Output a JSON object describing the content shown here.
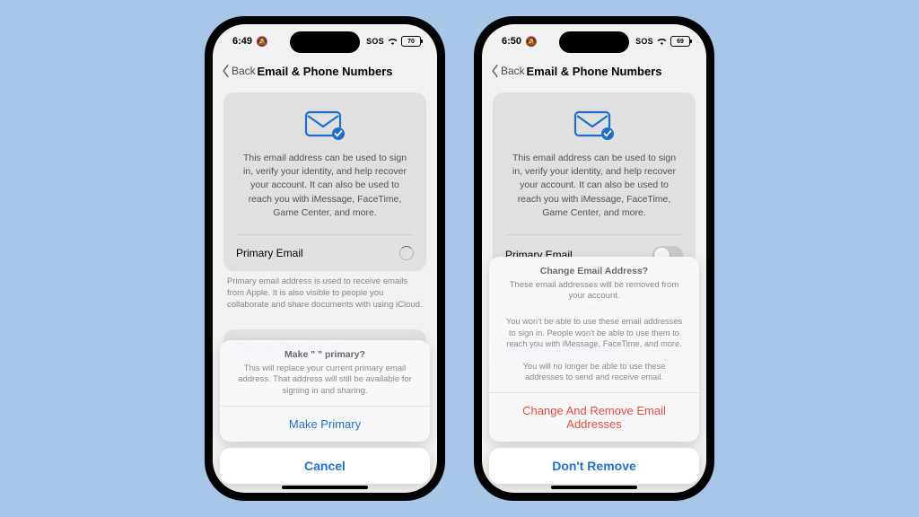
{
  "status": {
    "time_left": "6:49",
    "time_right": "6:50",
    "bell": "🔕",
    "sos": "SOS",
    "batt_left": "70",
    "batt_right": "69"
  },
  "nav": {
    "back": "Back",
    "title": "Email & Phone Numbers"
  },
  "card": {
    "desc": "This email address can be used to sign in, verify your identity, and help recover your account. It can also be used to reach you with iMessage, FaceTime, Game Center, and more.",
    "primary_label": "Primary Email",
    "footnote": "Primary email address is used to receive emails from Apple. It is also visible to people you collaborate and share documents with using iCloud."
  },
  "left": {
    "remove_link": "Remove from Account",
    "sheet_title": "Make \"                                  \" primary?",
    "sheet_sub": "This will replace your current primary email address. That address will still be available for signing in and sharing.",
    "make_primary": "Make Primary",
    "cancel": "Cancel"
  },
  "right": {
    "change_link": "Change Email Address",
    "alert_title": "Change Email Address?",
    "alert_sub": "These email addresses will be removed from your account.",
    "alert_p1": "You won't be able to use these email addresses to sign in. People won't be able to use them to reach you with iMessage, FaceTime, and more.",
    "alert_p2": "You will no longer be able to use these addresses to send and receive email.",
    "change_remove": "Change And Remove Email Addresses",
    "dont_remove": "Don't Remove"
  }
}
